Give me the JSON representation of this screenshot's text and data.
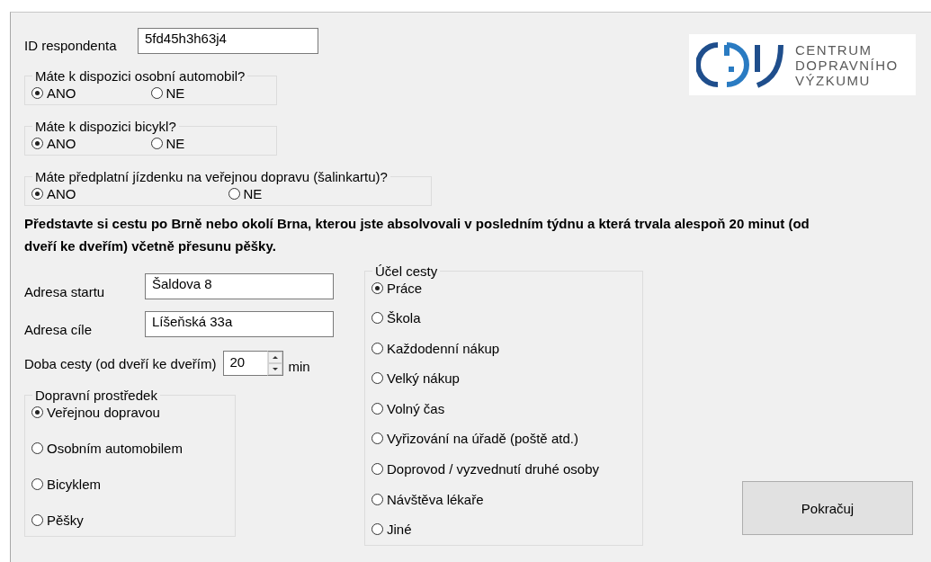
{
  "respondent_id": {
    "label": "ID respondenta",
    "value": "5fd45h3h63j4"
  },
  "logo": {
    "lines": [
      "CENTRUM",
      "DOPRAVNÍHO",
      "VÝZKUMU"
    ]
  },
  "questions": [
    {
      "legend": "Máte k dispozici osobní automobil?",
      "options": [
        {
          "label": "ANO",
          "selected": true
        },
        {
          "label": "NE",
          "selected": false
        }
      ]
    },
    {
      "legend": "Máte k dispozici bicykl?",
      "options": [
        {
          "label": "ANO",
          "selected": true
        },
        {
          "label": "NE",
          "selected": false
        }
      ]
    },
    {
      "legend": "Máte předplatní jízdenku na veřejnou dopravu (šalinkartu)?",
      "options": [
        {
          "label": "ANO",
          "selected": true
        },
        {
          "label": "NE",
          "selected": false
        }
      ]
    }
  ],
  "instruction": "Představte si cestu po Brně nebo okolí Brna, kterou jste absolvovali v posledním týdnu a která trvala alespoň 20 minut (od dveří ke dveřím) včetně přesunu pěšky.",
  "fields": [
    {
      "label": "Adresa startu",
      "value": "Šaldova 8"
    },
    {
      "label": "Adresa cíle",
      "value": "Líšeňská 33a"
    }
  ],
  "duration": {
    "label": "Doba cesty (od dveří ke dveřím)",
    "value": "20",
    "unit": "min"
  },
  "transport": {
    "legend": "Dopravní prostředek",
    "options": [
      {
        "label": "Veřejnou dopravou",
        "selected": true
      },
      {
        "label": "Osobním automobilem",
        "selected": false
      },
      {
        "label": "Bicyklem",
        "selected": false
      },
      {
        "label": "Pěšky",
        "selected": false
      }
    ]
  },
  "purpose": {
    "legend": "Účel cesty",
    "options": [
      {
        "label": "Práce",
        "selected": true
      },
      {
        "label": "Škola",
        "selected": false
      },
      {
        "label": "Každodenní nákup",
        "selected": false
      },
      {
        "label": "Velký nákup",
        "selected": false
      },
      {
        "label": "Volný čas",
        "selected": false
      },
      {
        "label": "Vyřizování na úřadě (poště atd.)",
        "selected": false
      },
      {
        "label": "Doprovod / vyzvednutí druhé osoby",
        "selected": false
      },
      {
        "label": "Návštěva lékaře",
        "selected": false
      },
      {
        "label": "Jiné",
        "selected": false
      }
    ]
  },
  "continue_button": "Pokračuj"
}
